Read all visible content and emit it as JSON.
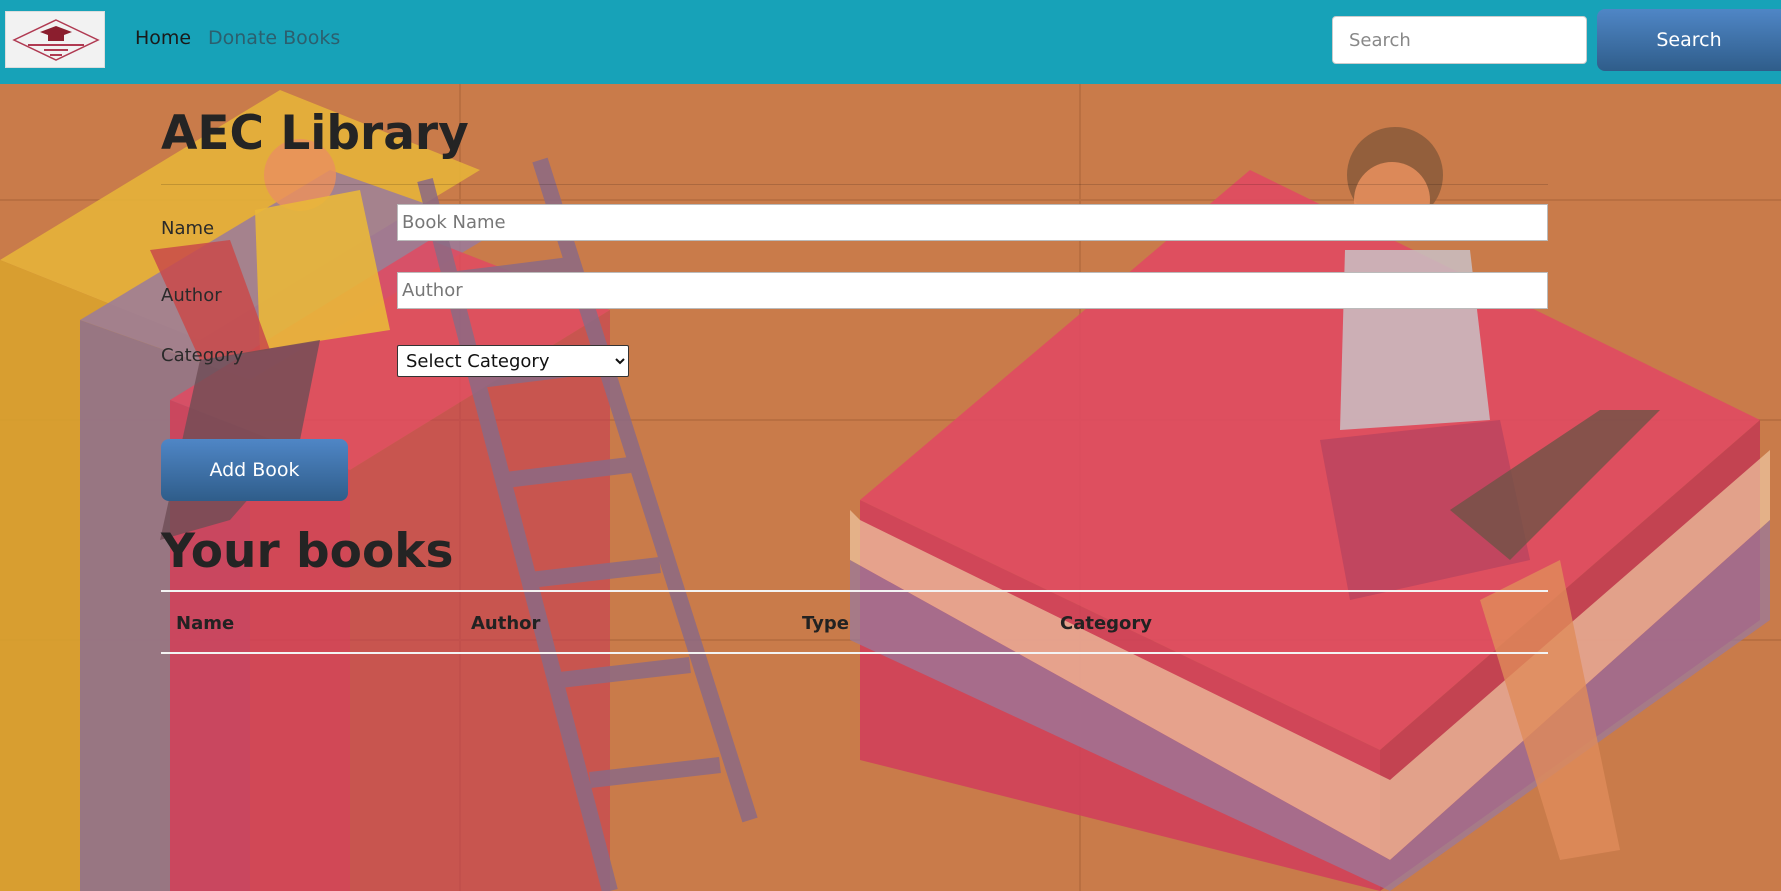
{
  "navbar": {
    "home_label": "Home",
    "donate_label": "Donate Books",
    "search_placeholder": "Search",
    "search_button": "Search",
    "background_color": "#17a2b8"
  },
  "form": {
    "title": "AEC Library",
    "name_label": "Name",
    "name_placeholder": "Book Name",
    "author_label": "Author",
    "author_placeholder": "Author",
    "category_label": "Category",
    "category_selected": "Select Category",
    "add_button": "Add Book"
  },
  "books": {
    "title": "Your books",
    "columns": [
      "Name",
      "Author",
      "Type",
      "Category"
    ],
    "rows": []
  },
  "colors": {
    "button_gradient_top": "#4f86c6",
    "button_gradient_bottom": "#2f5d8a",
    "background_wood": "#c97b4a",
    "book_red": "#d8465a"
  }
}
